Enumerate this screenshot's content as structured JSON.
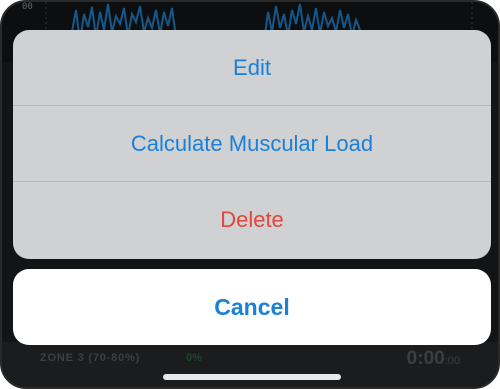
{
  "background": {
    "scale_label": "00",
    "zone_label": "ZONE 3 (70-80%)",
    "zone_percent": "0%",
    "time_main": "0:00",
    "time_sub": ":00"
  },
  "action_sheet": {
    "actions": [
      {
        "label": "Edit",
        "style": "default"
      },
      {
        "label": "Calculate Muscular Load",
        "style": "default"
      },
      {
        "label": "Delete",
        "style": "destructive"
      }
    ],
    "cancel_label": "Cancel"
  },
  "colors": {
    "accent": "#1a80d8",
    "destructive": "#e2463d",
    "zone_green": "#2f6a43"
  }
}
